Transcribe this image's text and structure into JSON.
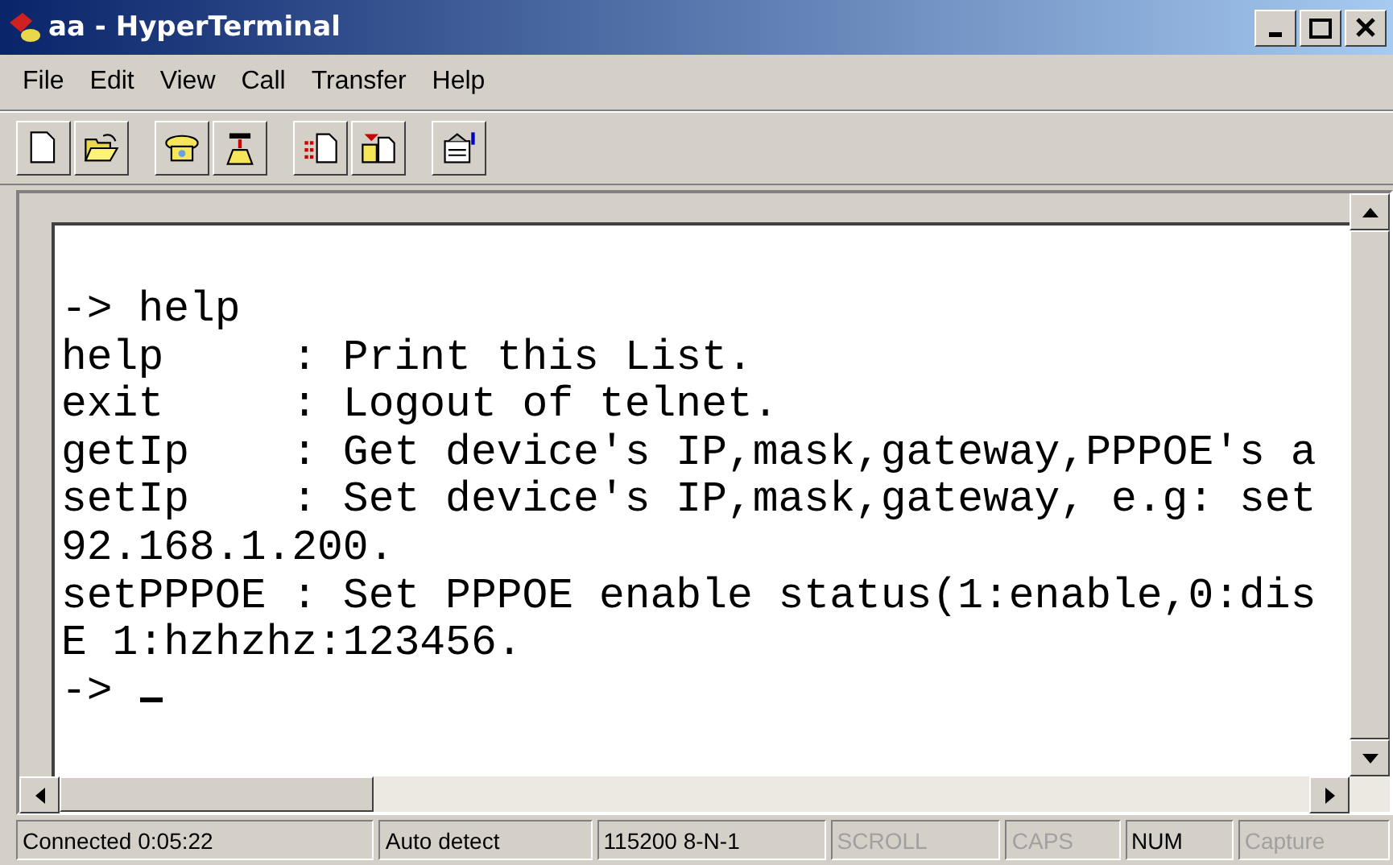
{
  "window": {
    "title": "aa - HyperTerminal"
  },
  "menu": [
    "File",
    "Edit",
    "View",
    "Call",
    "Transfer",
    "Help"
  ],
  "toolbar": [
    {
      "kind": "new"
    },
    {
      "kind": "open"
    },
    {
      "kind": "call"
    },
    {
      "kind": "hangup"
    },
    {
      "kind": "sendfile"
    },
    {
      "kind": "receive"
    },
    {
      "kind": "properties"
    }
  ],
  "terminal": {
    "lines": [
      "-> help",
      "help     : Print this List.",
      "exit     : Logout of telnet.",
      "getIp    : Get device's IP,mask,gateway,PPPOE's a",
      "setIp    : Set device's IP,mask,gateway, e.g: set",
      "92.168.1.200.",
      "setPPPOE : Set PPPOE enable status(1:enable,0:dis",
      "E 1:hzhzhz:123456."
    ],
    "prompt": "->"
  },
  "status_bar": [
    {
      "text": "Connected 0:05:22",
      "active": true
    },
    {
      "text": "Auto detect",
      "active": true
    },
    {
      "text": "115200 8-N-1",
      "active": true
    },
    {
      "text": "SCROLL",
      "active": false
    },
    {
      "text": "CAPS",
      "active": false
    },
    {
      "text": "NUM",
      "active": true
    },
    {
      "text": "Capture",
      "active": false
    }
  ]
}
